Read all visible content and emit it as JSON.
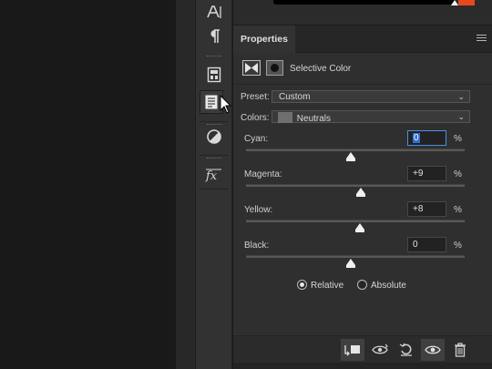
{
  "panel": {
    "tab_label": "Properties",
    "adjustment_title": "Selective Color"
  },
  "preset": {
    "label": "Preset:",
    "value": "Custom"
  },
  "colors": {
    "label": "Colors:",
    "value": "Neutrals",
    "swatch_color": "#6f6f6f"
  },
  "sliders": [
    {
      "label": "Cyan:",
      "value": "0",
      "unit": "%",
      "level": 0
    },
    {
      "label": "Magenta:",
      "value": "+9",
      "unit": "%",
      "level": 9
    },
    {
      "label": "Yellow:",
      "value": "+8",
      "unit": "%",
      "level": 8
    },
    {
      "label": "Black:",
      "value": "0",
      "unit": "%",
      "level": 0
    }
  ],
  "method": {
    "relative_label": "Relative",
    "absolute_label": "Absolute",
    "selected": "relative"
  },
  "toolbar_icons": [
    "type-icon",
    "paragraph-icon",
    "character-styles-icon",
    "paragraph-styles-icon",
    "adjustments-icon",
    "layer-style-icon"
  ],
  "footer_icons": [
    "clip-to-layer-icon",
    "view-previous-state-icon",
    "reset-icon",
    "visibility-icon",
    "delete-icon"
  ],
  "colors_theme": {
    "accent_orange": "#e8481e",
    "focus_blue": "#4a8fe8"
  }
}
